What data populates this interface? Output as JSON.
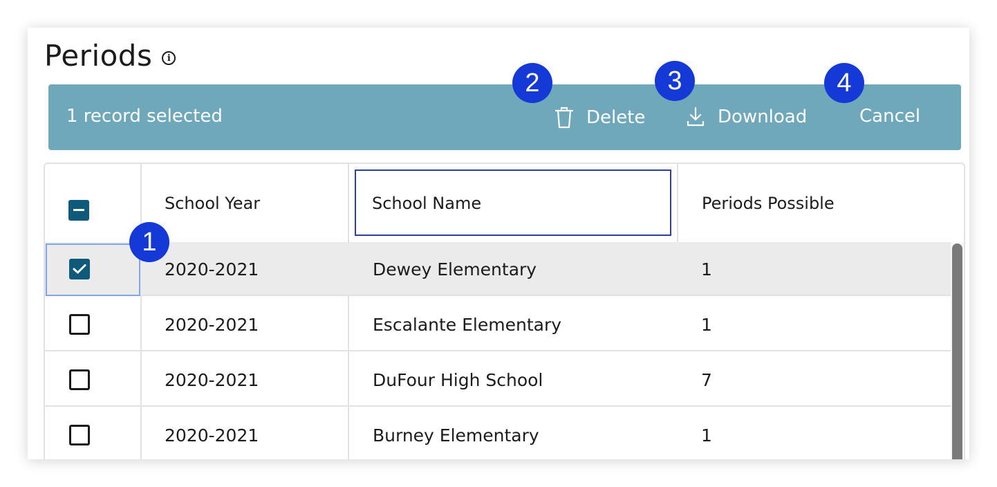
{
  "page": {
    "title": "Periods",
    "info_icon": "info-icon"
  },
  "action_bar": {
    "selection_text": "1 record selected",
    "delete_label": "Delete",
    "download_label": "Download",
    "cancel_label": "Cancel",
    "color": "#6fa8bb"
  },
  "badges": [
    "1",
    "2",
    "3",
    "4"
  ],
  "table": {
    "columns": [
      "School Year",
      "School Name",
      "Periods Possible"
    ],
    "rows": [
      {
        "year": "2020-2021",
        "school": "Dewey Elementary",
        "periods": "1",
        "checked": true
      },
      {
        "year": "2020-2021",
        "school": "Escalante Elementary",
        "periods": "1",
        "checked": false
      },
      {
        "year": "2020-2021",
        "school": "DuFour High School",
        "periods": "7",
        "checked": false
      },
      {
        "year": "2020-2021",
        "school": "Burney Elementary",
        "periods": "1",
        "checked": false
      }
    ],
    "checkbox_color": "#0f5a7a"
  },
  "badge_color": "#1439d6"
}
